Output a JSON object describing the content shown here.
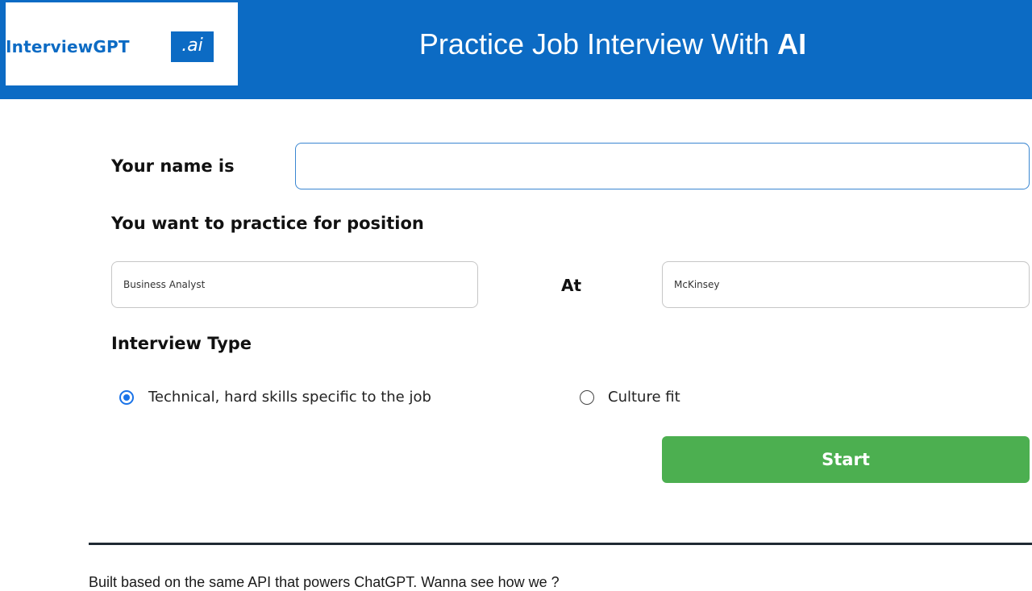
{
  "header": {
    "logo_text": "InterviewGPT",
    "logo_badge": ".ai",
    "title_prefix": "Practice Job Interview With ",
    "title_emphasis": "AI",
    "background_color": "#0c6bc4"
  },
  "form": {
    "name_label": "Your name is",
    "name_value": "",
    "position_label": "You want to practice for position",
    "position_value": "Business Analyst",
    "at_label": "At",
    "company_value": "McKinsey",
    "interview_type_label": "Interview Type",
    "interview_types": [
      {
        "label": "Technical, hard skills specific to the job",
        "checked": true
      },
      {
        "label": "Culture fit",
        "checked": false
      }
    ],
    "start_label": "Start",
    "start_color": "#4caf50",
    "radio_accent": "#1a73e8"
  },
  "footer": {
    "text": "Built based on the same API that powers ChatGPT. Wanna see how we ?"
  }
}
